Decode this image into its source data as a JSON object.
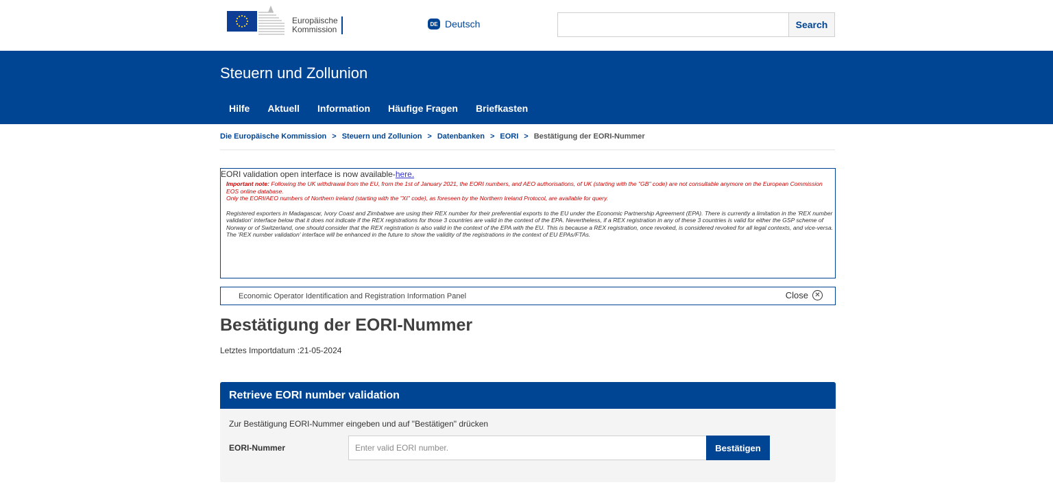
{
  "header": {
    "logo_line1": "Europäische",
    "logo_line2": "Kommission",
    "language_code": "DE",
    "language_label": "Deutsch",
    "search_button": "Search",
    "search_value": ""
  },
  "site": {
    "title": "Steuern und Zollunion",
    "nav": [
      "Hilfe",
      "Aktuell",
      "Information",
      "Häufige Fragen",
      "Briefkasten"
    ]
  },
  "breadcrumb": {
    "items": [
      "Die Europäische Kommission",
      "Steuern und Zollunion",
      "Datenbanken",
      "EORI"
    ],
    "separator": ">",
    "current": "Bestätigung der EORI-Nummer"
  },
  "notice": {
    "head_text": "EORI validation open interface is now available-",
    "head_link": "here.",
    "important_label": "Important note:",
    "important_text": " Following the UK withdrawal from the EU, from the 1st of January 2021, the EORI numbers, and AEO authorisations, of UK (starting with the \"GB\" code) are not consultable anymore on the European Commission EOS online database.",
    "ni_text": "Only the EORI/AEO numbers of Northern Ireland (starting with the \"XI\" code), as foreseen by the Northern Ireland Protocol, are available for query.",
    "rex_text": "Registered exporters in Madagascar, Ivory Coast and Zimbabwe are using their REX number for their preferential exports to the EU under the Economic Partnership Agreement (EPA). There is currently a limitation in the 'REX number validation' interface below that it does not indicate if the REX registrations for those 3 countries are valid in the context of the EPA. Nevertheless, if a REX registration in any of these 3 countries is valid for either the GSP scheme of Norway or of Switzerland, one should consider that the REX registration is also valid in the context of the EPA with the EU. This is because a REX registration, once revoked, is considered revoked for all legal contexts, and vice-versa.",
    "rex_future": "The 'REX number validation' interface will be enhanced in the future to show the validity of the registrations in the context of EU EPAs/FTAs."
  },
  "info_panel": {
    "label": "Economic Operator Identification and Registration Information Panel",
    "close_label": "Close",
    "close_glyph": "✕"
  },
  "page": {
    "title": "Bestätigung der EORI-Nummer",
    "import_date": "Letztes Importdatum :21-05-2024"
  },
  "form": {
    "heading": "Retrieve EORI number validation",
    "instructions": "Zur Bestätigung EORI-Nummer eingeben und auf \"Bestätigen\" drücken",
    "field_label": "EORI-Nummer",
    "placeholder": "Enter valid EORI number.",
    "value": "",
    "submit_label": "Bestätigen"
  },
  "colors": {
    "brand_blue": "#004494",
    "notice_red": "#cc0000",
    "card_bg": "#f4f4f4"
  }
}
